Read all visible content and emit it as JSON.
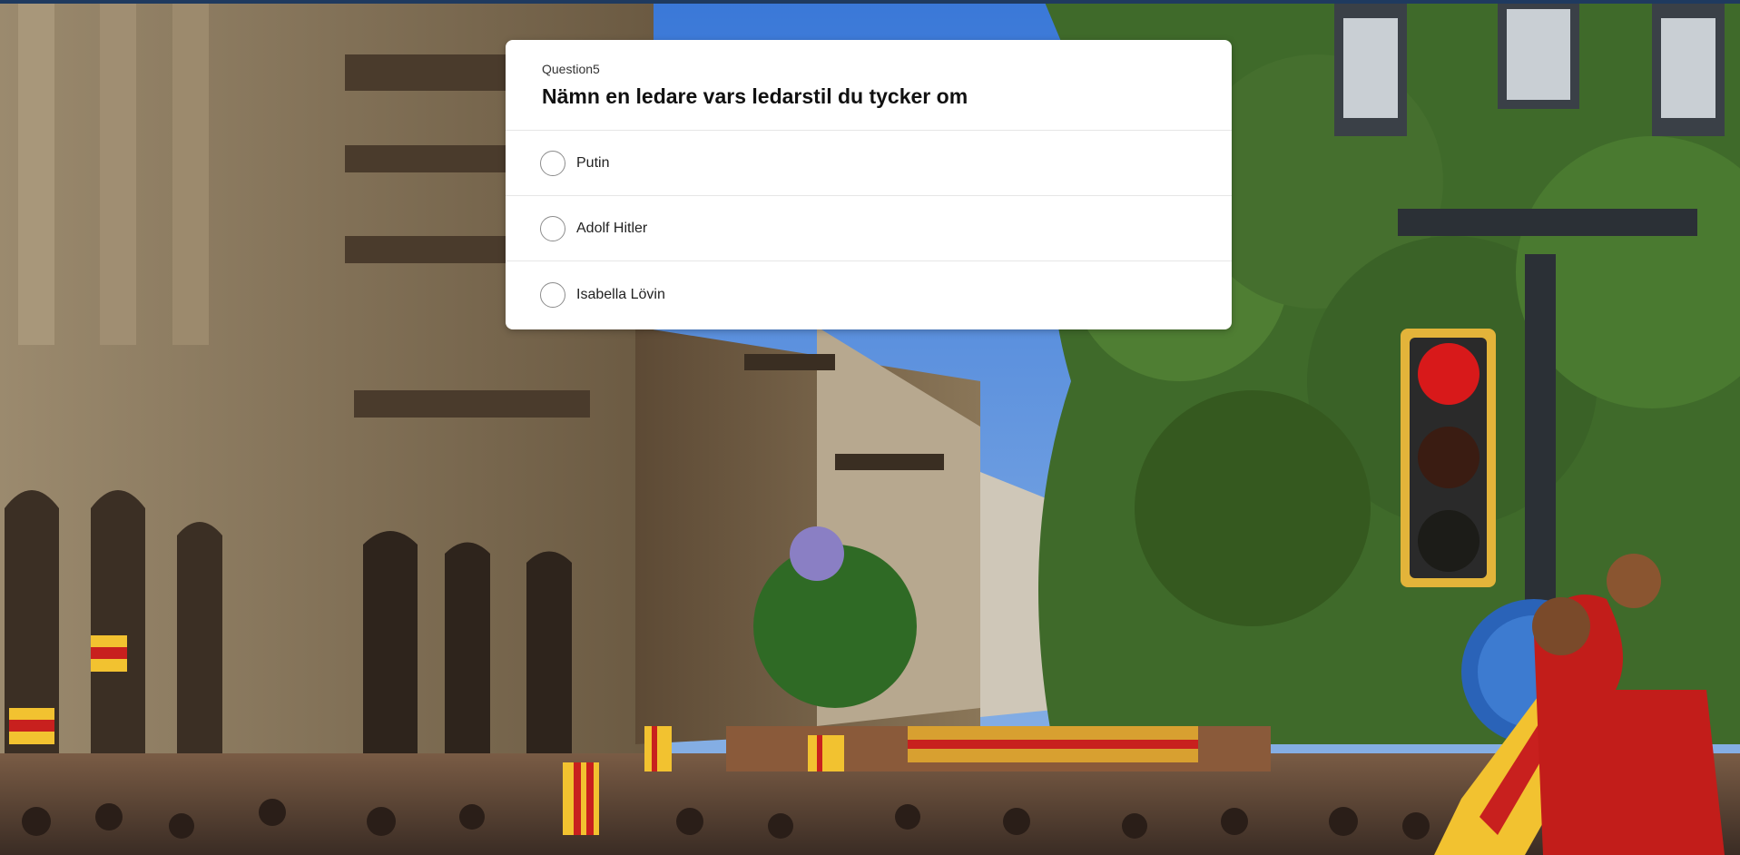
{
  "question": {
    "number_label": "Question5",
    "title": "Nämn en ledare vars ledarstil du tycker om",
    "options": [
      {
        "label": "Putin"
      },
      {
        "label": "Adolf Hitler"
      },
      {
        "label": "Isabella Lövin"
      }
    ]
  },
  "background": {
    "description_icon": "street-demonstration-photo",
    "sky_color": "#4f86d6",
    "building_color": "#8a7557",
    "tree_color": "#3f6a2a",
    "flag_red": "#c8201e",
    "flag_yellow": "#f2c230"
  }
}
